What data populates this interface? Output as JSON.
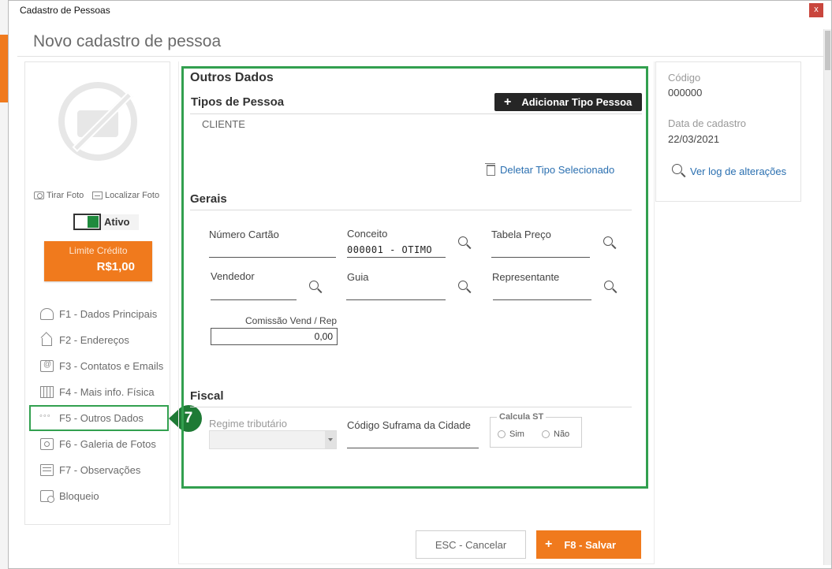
{
  "window": {
    "title": "Cadastro de Pessoas",
    "close_label": "x"
  },
  "page": {
    "title": "Novo cadastro de pessoa"
  },
  "left": {
    "take_photo": "Tirar Foto",
    "find_photo": "Localizar Foto",
    "status_label": "Ativo",
    "status_on": true,
    "credit_label": "Limite Crédito",
    "credit_value": "R$1,00",
    "nav": [
      {
        "label": "F1 - Dados Principais",
        "icon": "person-icon"
      },
      {
        "label": "F2 - Endereços",
        "icon": "house-icon"
      },
      {
        "label": "F3 - Contatos e Emails",
        "icon": "contact-icon"
      },
      {
        "label": "F4 - Mais info. Física",
        "icon": "grid-icon"
      },
      {
        "label": "F5 - Outros Dados",
        "icon": "dots-icon",
        "active": true
      },
      {
        "label": "F6 - Galeria de Fotos",
        "icon": "photo-icon"
      },
      {
        "label": "F7 - Observações",
        "icon": "note-icon"
      },
      {
        "label": "Bloqueio",
        "icon": "block-icon"
      }
    ]
  },
  "step_badge": "7",
  "form": {
    "section_title": "Outros Dados",
    "types_title": "Tipos de Pessoa",
    "add_type_label": "Adicionar Tipo Pessoa",
    "types": [
      "CLIENTE"
    ],
    "delete_type_label": "Deletar Tipo Selecionado",
    "gerais_title": "Gerais",
    "numero_cartao_label": "Número Cartão",
    "numero_cartao_value": "",
    "conceito_label": "Conceito",
    "conceito_value": "000001 - OTIMO",
    "tabela_preco_label": "Tabela Preço",
    "tabela_preco_value": "",
    "vendedor_label": "Vendedor",
    "guia_label": "Guia",
    "representante_label": "Representante",
    "comissao_label": "Comissão Vend / Rep",
    "comissao_value": "0,00",
    "fiscal_title": "Fiscal",
    "regime_label": "Regime tributário",
    "regime_value": "",
    "suframa_label": "Código Suframa da Cidade",
    "calcula_st_label": "Calcula ST",
    "st_yes": "Sim",
    "st_no": "Não"
  },
  "info": {
    "codigo_label": "Código",
    "codigo_value": "000000",
    "data_label": "Data de cadastro",
    "data_value": "22/03/2021",
    "log_link": "Ver log de alterações"
  },
  "footer": {
    "cancel_label": "ESC - Cancelar",
    "save_label": "F8 - Salvar"
  },
  "colors": {
    "accent": "#f07a1d",
    "highlight": "#32a04f",
    "badge": "#1e7a35",
    "link": "#2a6fb0"
  }
}
